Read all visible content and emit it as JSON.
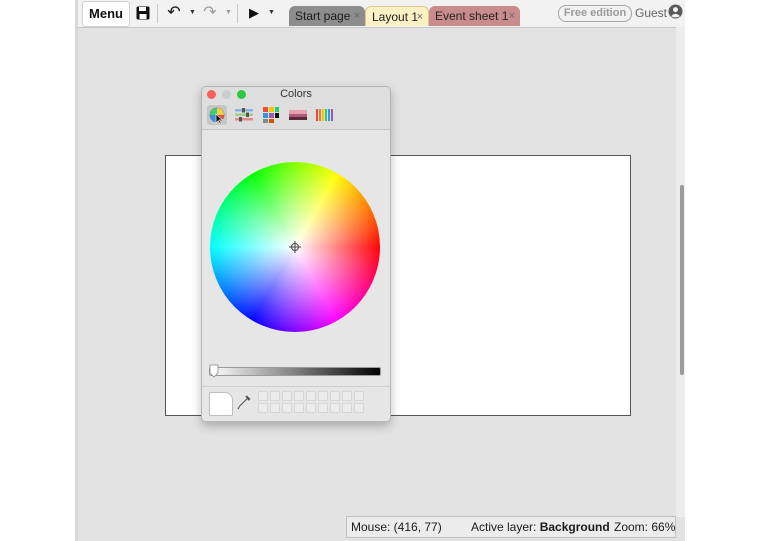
{
  "toolbar": {
    "menu_label": "Menu",
    "icons": [
      "save-icon",
      "undo-icon",
      "redo-icon",
      "play-icon"
    ]
  },
  "tabs": [
    {
      "label": "Start page",
      "close": "×",
      "active": false
    },
    {
      "label": "Layout 1",
      "close": "×",
      "active": true
    },
    {
      "label": "Event sheet 1",
      "close": "×",
      "active": false
    }
  ],
  "account": {
    "edition_label": "Free edition",
    "user_label": "Guest"
  },
  "colors_panel": {
    "title": "Colors",
    "modes": [
      "color-wheel",
      "color-sliders",
      "color-palettes",
      "image-palettes",
      "crayons"
    ],
    "active_mode": "color-wheel",
    "brightness": 1.0,
    "current_color": "#ffffff"
  },
  "statusbar": {
    "mouse_label": "Mouse: (416, 77)",
    "active_layer_prefix": "Active layer: ",
    "active_layer_value": "Background",
    "zoom_label": "Zoom: 66%"
  },
  "colors": {
    "tab_start": "#8d8d8d",
    "tab_layout": "#fbf1c4",
    "tab_event": "#c98b8b",
    "workspace": "#e3e3e3"
  }
}
